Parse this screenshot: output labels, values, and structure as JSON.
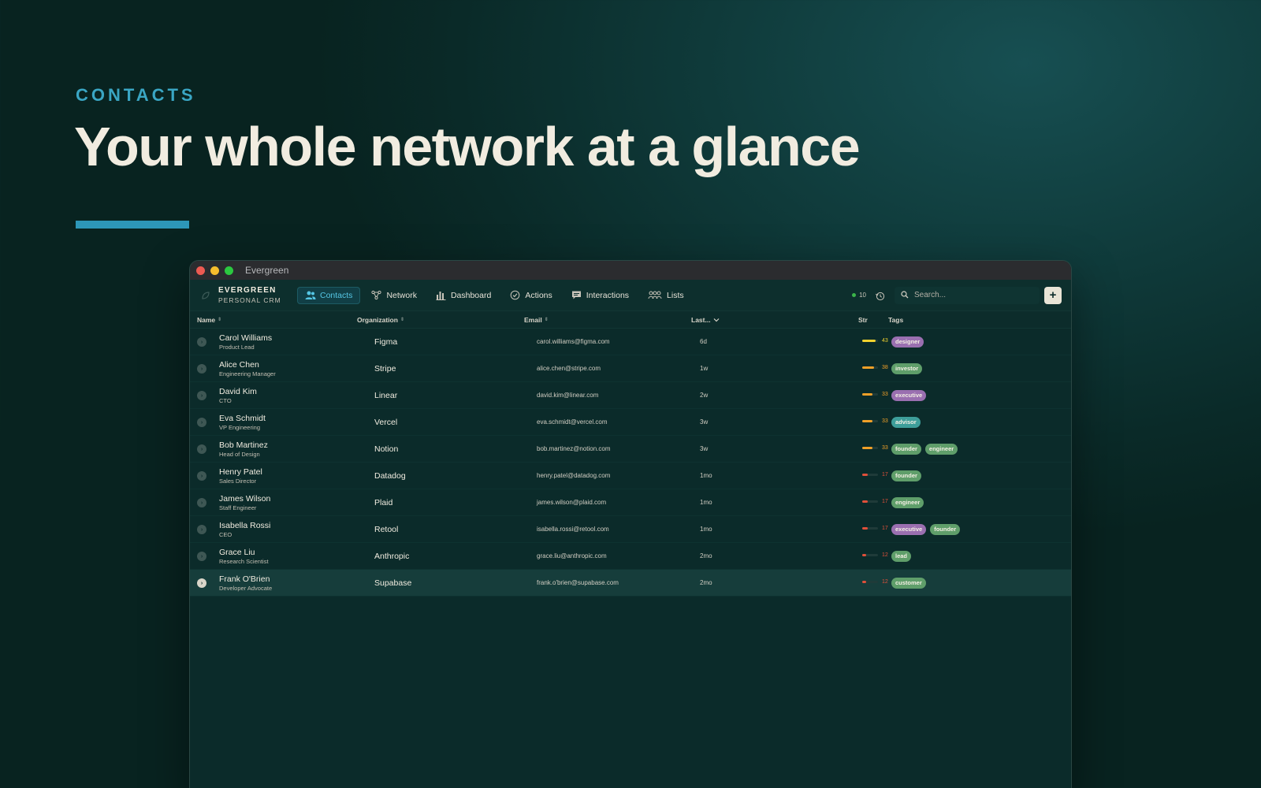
{
  "hero": {
    "eyebrow": "CONTACTS",
    "headline": "Your whole network at a glance"
  },
  "window": {
    "title": "Evergreen"
  },
  "brand": {
    "name": "EVERGREEN",
    "subtitle": "PERSONAL CRM"
  },
  "nav": [
    {
      "label": "Contacts",
      "icon": "contacts-icon",
      "active": true
    },
    {
      "label": "Network",
      "icon": "network-icon",
      "active": false
    },
    {
      "label": "Dashboard",
      "icon": "dashboard-icon",
      "active": false
    },
    {
      "label": "Actions",
      "icon": "actions-icon",
      "active": false
    },
    {
      "label": "Interactions",
      "icon": "interactions-icon",
      "active": false
    },
    {
      "label": "Lists",
      "icon": "lists-icon",
      "active": false
    }
  ],
  "status": {
    "online_count": "10"
  },
  "search": {
    "placeholder": "Search..."
  },
  "add_button": {
    "label": "+"
  },
  "columns": {
    "name": "Name",
    "organization": "Organization",
    "email": "Email",
    "last": "Last...",
    "strength": "Str",
    "tags": "Tags"
  },
  "tag_colors": {
    "designer": "#9a6fb0",
    "investor": "#5f9e6a",
    "executive": "#9a6fb0",
    "advisor": "#3e9e9a",
    "founder": "#5f9e6a",
    "engineer": "#5f9e6a",
    "lead": "#5f9e6a",
    "customer": "#5f9e6a"
  },
  "strength_colors": {
    "high": "#f2d22e",
    "medium": "#f0a028",
    "low": "#e0503a"
  },
  "contacts": [
    {
      "name": "Carol Williams",
      "title": "Product Lead",
      "organization": "Figma",
      "email": "carol.williams@figma.com",
      "last": "6d",
      "strength": 43,
      "level": "high",
      "tags": [
        "designer"
      ]
    },
    {
      "name": "Alice Chen",
      "title": "Engineering Manager",
      "organization": "Stripe",
      "email": "alice.chen@stripe.com",
      "last": "1w",
      "strength": 38,
      "level": "medium",
      "tags": [
        "investor"
      ]
    },
    {
      "name": "David Kim",
      "title": "CTO",
      "organization": "Linear",
      "email": "david.kim@linear.com",
      "last": "2w",
      "strength": 33,
      "level": "medium",
      "tags": [
        "executive"
      ]
    },
    {
      "name": "Eva Schmidt",
      "title": "VP Engineering",
      "organization": "Vercel",
      "email": "eva.schmidt@vercel.com",
      "last": "3w",
      "strength": 33,
      "level": "medium",
      "tags": [
        "advisor"
      ]
    },
    {
      "name": "Bob Martinez",
      "title": "Head of Design",
      "organization": "Notion",
      "email": "bob.martinez@notion.com",
      "last": "3w",
      "strength": 33,
      "level": "medium",
      "tags": [
        "founder",
        "engineer"
      ]
    },
    {
      "name": "Henry Patel",
      "title": "Sales Director",
      "organization": "Datadog",
      "email": "henry.patel@datadog.com",
      "last": "1mo",
      "strength": 17,
      "level": "low",
      "tags": [
        "founder"
      ]
    },
    {
      "name": "James Wilson",
      "title": "Staff Engineer",
      "organization": "Plaid",
      "email": "james.wilson@plaid.com",
      "last": "1mo",
      "strength": 17,
      "level": "low",
      "tags": [
        "engineer"
      ]
    },
    {
      "name": "Isabella Rossi",
      "title": "CEO",
      "organization": "Retool",
      "email": "isabella.rossi@retool.com",
      "last": "1mo",
      "strength": 17,
      "level": "low",
      "tags": [
        "executive",
        "founder"
      ]
    },
    {
      "name": "Grace Liu",
      "title": "Research Scientist",
      "organization": "Anthropic",
      "email": "grace.liu@anthropic.com",
      "last": "2mo",
      "strength": 12,
      "level": "low",
      "tags": [
        "lead"
      ]
    },
    {
      "name": "Frank O'Brien",
      "title": "Developer Advocate",
      "organization": "Supabase",
      "email": "frank.o'brien@supabase.com",
      "last": "2mo",
      "strength": 12,
      "level": "low",
      "tags": [
        "customer"
      ],
      "selected": true
    }
  ]
}
